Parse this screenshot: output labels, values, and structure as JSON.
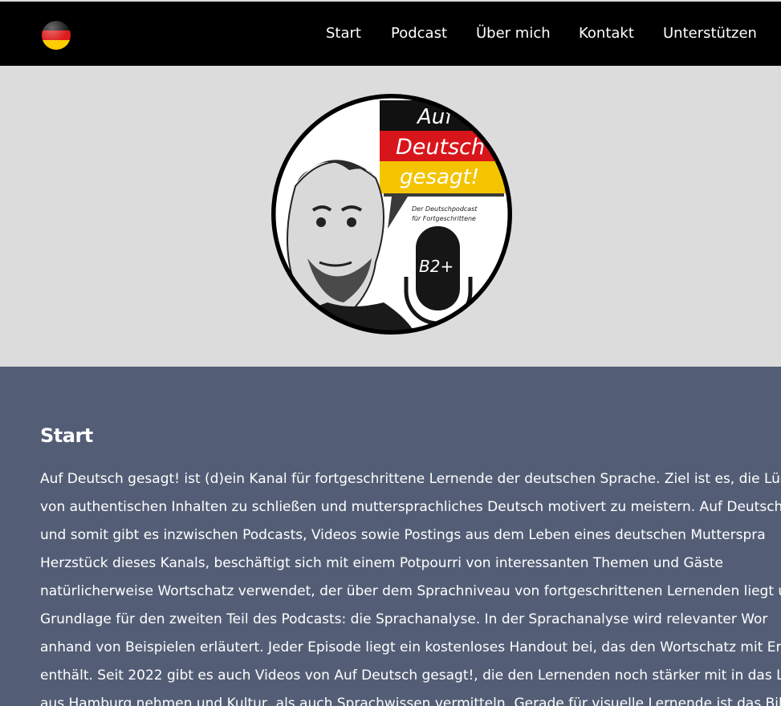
{
  "header": {
    "flag_icon": "germany-flag-icon",
    "nav": [
      {
        "label": "Start"
      },
      {
        "label": "Podcast"
      },
      {
        "label": "Über mich"
      },
      {
        "label": "Kontakt"
      },
      {
        "label": "Unterstützen"
      }
    ]
  },
  "hero": {
    "logo": {
      "title_line1": "Auf",
      "title_line2": "Deutsch",
      "title_line3": "gesagt!",
      "subtitle_line1": "Der Deutschpodcast",
      "subtitle_line2": "für Fortgeschrittene",
      "level": "B2+"
    }
  },
  "main": {
    "heading": "Start",
    "lines": [
      "Auf Deutsch gesagt! ist (d)ein Kanal für fortgeschrittene Lernende der deutschen Sprache. Ziel ist es, die Lücke",
      "von authentischen Inhalten zu schließen und muttersprachliches Deutsch motivert zu meistern. Auf Deutsch g",
      "und somit gibt es inzwischen Podcasts, Videos sowie Postings aus dem Leben eines deutschen Mutterspra",
      "Herzstück dieses Kanals, beschäftigt sich mit einem Potpourri von interessanten Themen und Gäste",
      "natürlicherweise Wortschatz verwendet, der über dem Sprachniveau von fortgeschrittenen Lernenden liegt und",
      "Grundlage für den zweiten Teil des Podcasts: die Sprachanalyse. In der Sprachanalyse wird relevanter Wor",
      "anhand von Beispielen erläutert. Jeder Episode liegt ein kostenloses Handout bei, das den Wortschatz mit Erklä",
      "enthält. Seit 2022 gibt es auch Videos von Auf Deutsch gesagt!, die den Lernenden noch stärker mit in das Lebe",
      "aus Hamburg nehmen und Kultur, als auch Sprachwissen vermitteln. Gerade für visuelle Lernende ist das Bild"
    ]
  }
}
